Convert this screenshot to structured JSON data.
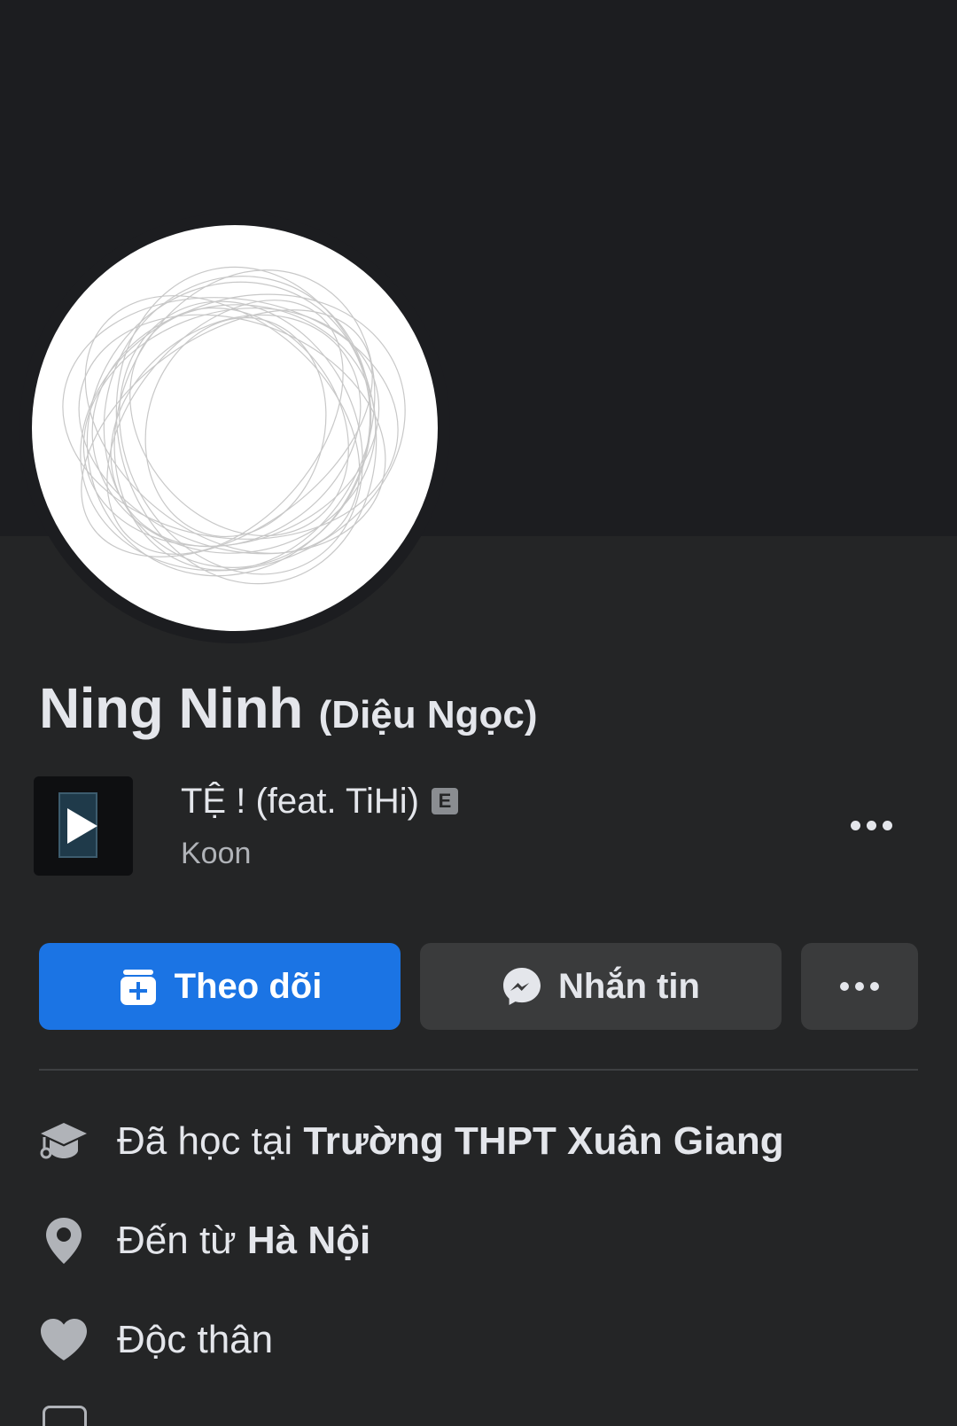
{
  "profile": {
    "name": "Ning Ninh",
    "alternate_name": "(Diệu Ngọc)"
  },
  "profile_music": {
    "song_title": "TỆ ! (feat. TiHi)",
    "explicit_badge": "E",
    "artist": "Koon",
    "icons": [
      "play-icon",
      "more-icon"
    ]
  },
  "actions": {
    "follow_label": "Theo dõi",
    "message_label": "Nhắn tin",
    "follow_icon": "follow-plus-icon",
    "message_icon": "messenger-icon",
    "more_icon": "more-icon"
  },
  "intro": {
    "education": {
      "prefix": "Đã học tại ",
      "value": "Trường THPT Xuân Giang",
      "icon": "graduation-cap-icon"
    },
    "hometown": {
      "prefix": "Đến từ ",
      "value": "Hà Nội",
      "icon": "location-pin-icon"
    },
    "relationship": {
      "value": "Độc thân",
      "icon": "heart-icon"
    }
  },
  "colors": {
    "background": "#242526",
    "cover": "#1c1d20",
    "primary_button": "#1b74e4",
    "secondary_button": "#3a3b3c",
    "text": "#e4e6eb",
    "muted_text": "#b0b3b8",
    "icon": "#b0b3b8"
  }
}
